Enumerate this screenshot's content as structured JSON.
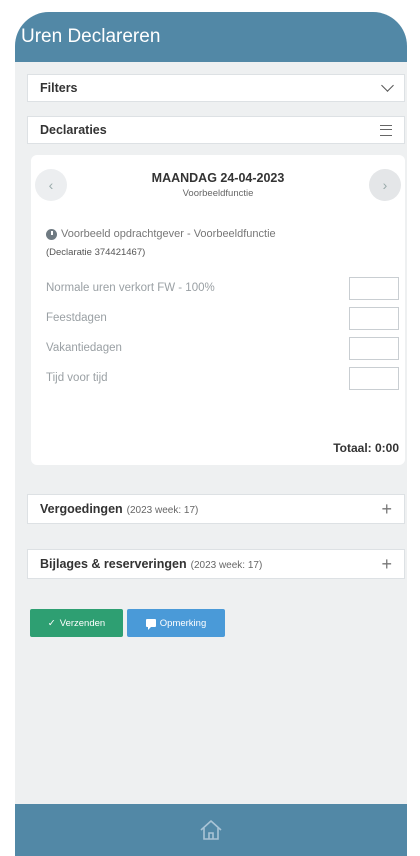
{
  "header": {
    "title": "Uren Declareren"
  },
  "filters": {
    "label": "Filters"
  },
  "declaraties": {
    "label": "Declaraties"
  },
  "day": {
    "date": "MAANDAG 24-04-2023",
    "role": "Voorbeeldfunctie",
    "client": "Voorbeeld opdrachtgever - Voorbeeldfunctie",
    "declaration": "(Declaratie 374421467)",
    "rows": [
      {
        "label": "Normale uren verkort FW - 100%",
        "value": ""
      },
      {
        "label": "Feestdagen",
        "value": ""
      },
      {
        "label": "Vakantiedagen",
        "value": ""
      },
      {
        "label": "Tijd voor tijd",
        "value": ""
      }
    ],
    "total": "Totaal: 0:00"
  },
  "vergoedingen": {
    "label": "Vergoedingen",
    "sub": "(2023 week: 17)"
  },
  "bijlages": {
    "label": "Bijlages & reserveringen",
    "sub": "(2023 week: 17)"
  },
  "actions": {
    "send": "Verzenden",
    "note": "Opmerking"
  },
  "colors": {
    "header": "#5288a6",
    "send": "#2e9f72",
    "note": "#4a9ad8"
  },
  "icons": [
    "chevron-down-icon",
    "menu-icon",
    "chevron-left-icon",
    "chevron-right-icon",
    "clock-icon",
    "plus-icon",
    "check-icon",
    "comment-icon",
    "home-icon"
  ]
}
